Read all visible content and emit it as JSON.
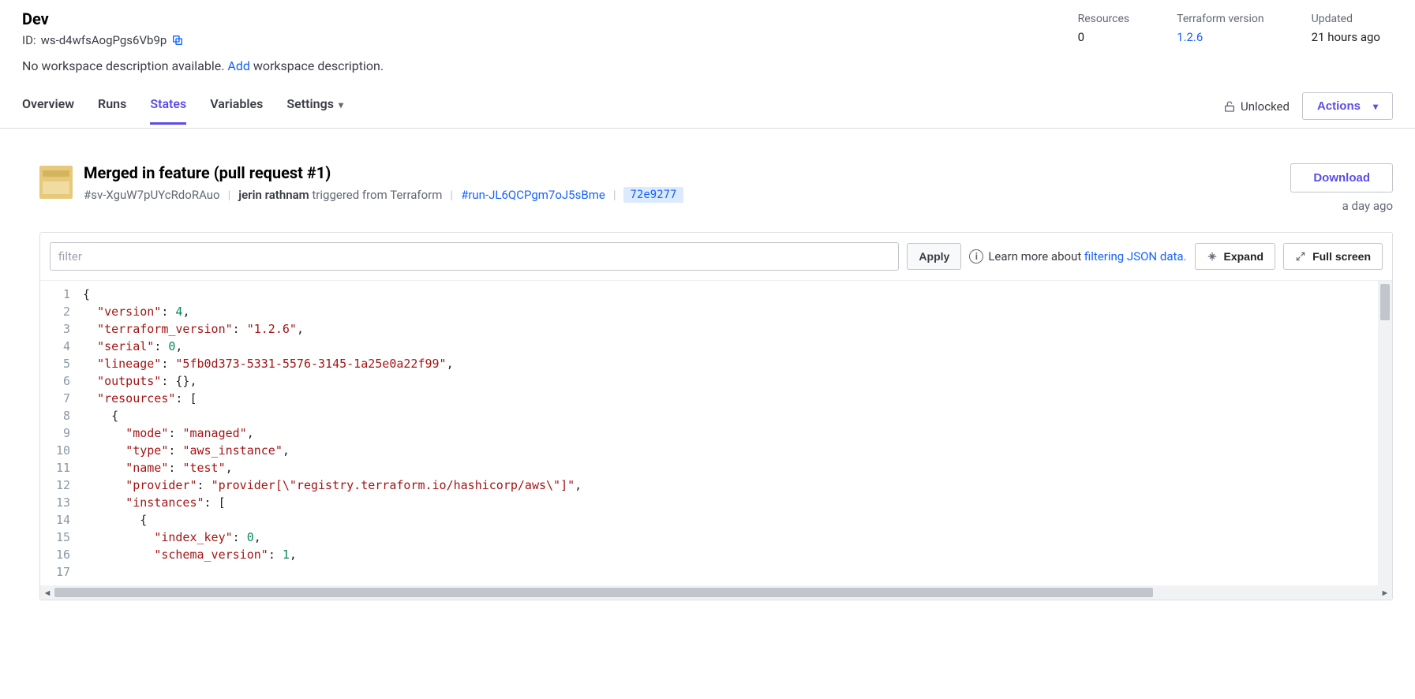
{
  "workspace": {
    "name": "Dev",
    "id_label": "ID: ",
    "id": "ws-d4wfsAogPgs6Vb9p",
    "desc_prefix": "No workspace description available. ",
    "desc_link": "Add",
    "desc_suffix": " workspace description."
  },
  "stats": {
    "resources_label": "Resources",
    "resources_value": "0",
    "tf_label": "Terraform version",
    "tf_value": "1.2.6",
    "updated_label": "Updated",
    "updated_value": "21 hours ago"
  },
  "tabs": {
    "overview": "Overview",
    "runs": "Runs",
    "states": "States",
    "variables": "Variables",
    "settings": "Settings"
  },
  "lock": {
    "label": "Unlocked"
  },
  "actions_btn": "Actions",
  "state": {
    "title": "Merged in feature (pull request #1)",
    "sv_id": "#sv-XguW7pUYcRdoRAuo",
    "user": "jerin rathnam",
    "triggered": " triggered from Terraform",
    "run_link": "#run-JL6QCPgm7oJ5sBme",
    "commit": "72e9277",
    "download": "Download",
    "ago": "a day ago"
  },
  "toolbar": {
    "filter_placeholder": "filter",
    "apply": "Apply",
    "learn_prefix": "Learn more about ",
    "learn_link": "filtering JSON data.",
    "expand": "Expand",
    "fullscreen": "Full screen"
  },
  "code": {
    "lines": [
      {
        "n": "1",
        "html": "<span class='tok-punc'>{</span>"
      },
      {
        "n": "2",
        "html": "  <span class='tok-key'>\"version\"</span><span class='tok-punc'>: </span><span class='tok-num'>4</span><span class='tok-punc'>,</span>"
      },
      {
        "n": "3",
        "html": "  <span class='tok-key'>\"terraform_version\"</span><span class='tok-punc'>: </span><span class='tok-str'>\"1.2.6\"</span><span class='tok-punc'>,</span>"
      },
      {
        "n": "4",
        "html": "  <span class='tok-key'>\"serial\"</span><span class='tok-punc'>: </span><span class='tok-num'>0</span><span class='tok-punc'>,</span>"
      },
      {
        "n": "5",
        "html": "  <span class='tok-key'>\"lineage\"</span><span class='tok-punc'>: </span><span class='tok-str'>\"5fb0d373-5331-5576-3145-1a25e0a22f99\"</span><span class='tok-punc'>,</span>"
      },
      {
        "n": "6",
        "html": "  <span class='tok-key'>\"outputs\"</span><span class='tok-punc'>: {},</span>"
      },
      {
        "n": "7",
        "html": "  <span class='tok-key'>\"resources\"</span><span class='tok-punc'>: [</span>"
      },
      {
        "n": "8",
        "html": "    <span class='tok-punc'>{</span>"
      },
      {
        "n": "9",
        "html": "      <span class='tok-key'>\"mode\"</span><span class='tok-punc'>: </span><span class='tok-str'>\"managed\"</span><span class='tok-punc'>,</span>"
      },
      {
        "n": "10",
        "html": "      <span class='tok-key'>\"type\"</span><span class='tok-punc'>: </span><span class='tok-str'>\"aws_instance\"</span><span class='tok-punc'>,</span>"
      },
      {
        "n": "11",
        "html": "      <span class='tok-key'>\"name\"</span><span class='tok-punc'>: </span><span class='tok-str'>\"test\"</span><span class='tok-punc'>,</span>"
      },
      {
        "n": "12",
        "html": "      <span class='tok-key'>\"provider\"</span><span class='tok-punc'>: </span><span class='tok-str'>\"provider[\\\"registry.terraform.io/hashicorp/aws\\\"]\"</span><span class='tok-punc'>,</span>"
      },
      {
        "n": "13",
        "html": "      <span class='tok-key'>\"instances\"</span><span class='tok-punc'>: [</span>"
      },
      {
        "n": "14",
        "html": "        <span class='tok-punc'>{</span>"
      },
      {
        "n": "15",
        "html": "          <span class='tok-key'>\"index_key\"</span><span class='tok-punc'>: </span><span class='tok-num'>0</span><span class='tok-punc'>,</span>"
      },
      {
        "n": "16",
        "html": "          <span class='tok-key'>\"schema_version\"</span><span class='tok-punc'>: </span><span class='tok-num'>1</span><span class='tok-punc'>,</span>"
      },
      {
        "n": "17",
        "html": ""
      }
    ]
  }
}
